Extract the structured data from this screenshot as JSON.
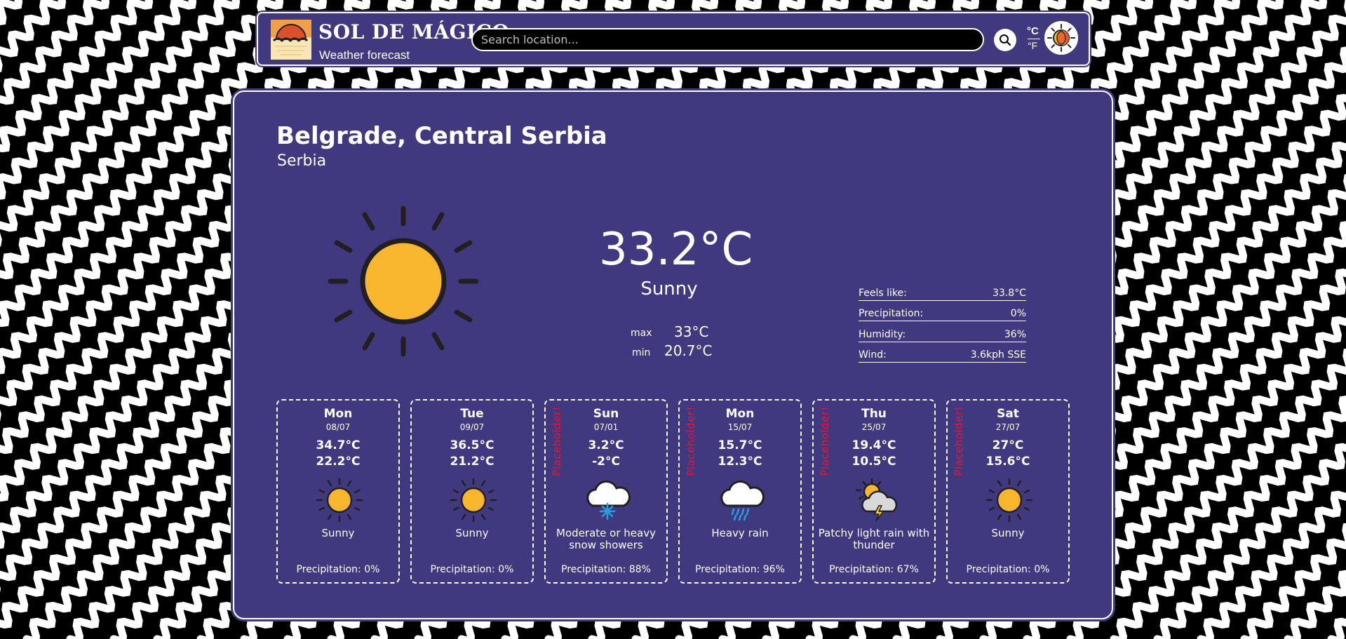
{
  "header": {
    "brand": "SOL DE MÁGICO",
    "tagline": "Weather forecast",
    "search_placeholder": "Search location...",
    "unit_celsius": "°C",
    "unit_fahrenheit": "°F"
  },
  "current": {
    "city": "Belgrade, Central Serbia",
    "country": "Serbia",
    "temperature": "33.2°C",
    "condition": "Sunny",
    "max_label": "max",
    "max_value": "33°C",
    "min_label": "min",
    "min_value": "20.7°C",
    "details": [
      {
        "label": "Feels like:",
        "value": "33.8°C"
      },
      {
        "label": "Precipitation:",
        "value": "0%"
      },
      {
        "label": "Humidity:",
        "value": "36%"
      },
      {
        "label": "Wind:",
        "value": "3.6kph SSE"
      }
    ]
  },
  "forecast": [
    {
      "day": "Mon",
      "date": "08/07",
      "max": "34.7°C",
      "min": "22.2°C",
      "icon": "sun-icon",
      "condition": "Sunny",
      "precipitation": "Precipitation: 0%",
      "placeholder": ""
    },
    {
      "day": "Tue",
      "date": "09/07",
      "max": "36.5°C",
      "min": "21.2°C",
      "icon": "sun-icon",
      "condition": "Sunny",
      "precipitation": "Precipitation: 0%",
      "placeholder": ""
    },
    {
      "day": "Sun",
      "date": "07/01",
      "max": "3.2°C",
      "min": "-2°C",
      "icon": "snow-cloud-icon",
      "condition": "Moderate or heavy snow showers",
      "precipitation": "Precipitation: 88%",
      "placeholder": "Placeholder!"
    },
    {
      "day": "Mon",
      "date": "15/07",
      "max": "15.7°C",
      "min": "12.3°C",
      "icon": "rain-cloud-icon",
      "condition": "Heavy rain",
      "precipitation": "Precipitation: 96%",
      "placeholder": "Placeholder!"
    },
    {
      "day": "Thu",
      "date": "25/07",
      "max": "19.4°C",
      "min": "10.5°C",
      "icon": "thunder-sun-cloud-icon",
      "condition": "Patchy light rain with thunder",
      "precipitation": "Precipitation: 67%",
      "placeholder": "Placeholder!"
    },
    {
      "day": "Sat",
      "date": "27/07",
      "max": "27°C",
      "min": "15.6°C",
      "icon": "sun-icon",
      "condition": "Sunny",
      "precipitation": "Precipitation: 0%",
      "placeholder": "Placeholder!"
    }
  ],
  "colors": {
    "panel": "#41397f",
    "sun": "#f8b62e",
    "placeholder_text": "#e0173d"
  }
}
